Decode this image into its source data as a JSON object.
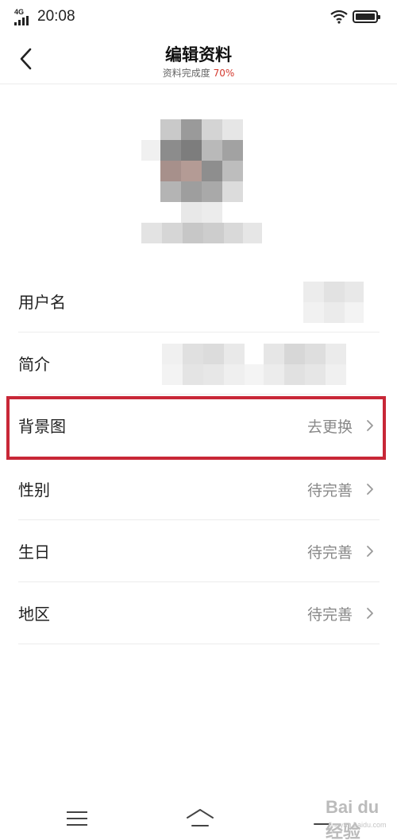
{
  "status_bar": {
    "network": "4G",
    "time": "20:08"
  },
  "header": {
    "title": "编辑资料",
    "subtitle_prefix": "资料完成度",
    "completion": "70%",
    "back_icon": "chevron-left-icon"
  },
  "profile": {
    "avatar_icon": "avatar-pixelated"
  },
  "fields": [
    {
      "label": "用户名",
      "value": ""
    },
    {
      "label": "简介",
      "value": ""
    },
    {
      "label": "背景图",
      "value": "去更换"
    },
    {
      "label": "性别",
      "value": "待完善"
    },
    {
      "label": "生日",
      "value": "待完善"
    },
    {
      "label": "地区",
      "value": "待完善"
    }
  ],
  "highlight_color": "#c82737",
  "accent_color": "#d43a2f",
  "bottom_nav": {
    "menu_icon": "menu-icon",
    "home_icon": "home-icon",
    "back_icon": "back-icon"
  },
  "watermark": {
    "text": "Bai du 经验",
    "sub": "jingyan.baidu.com"
  }
}
